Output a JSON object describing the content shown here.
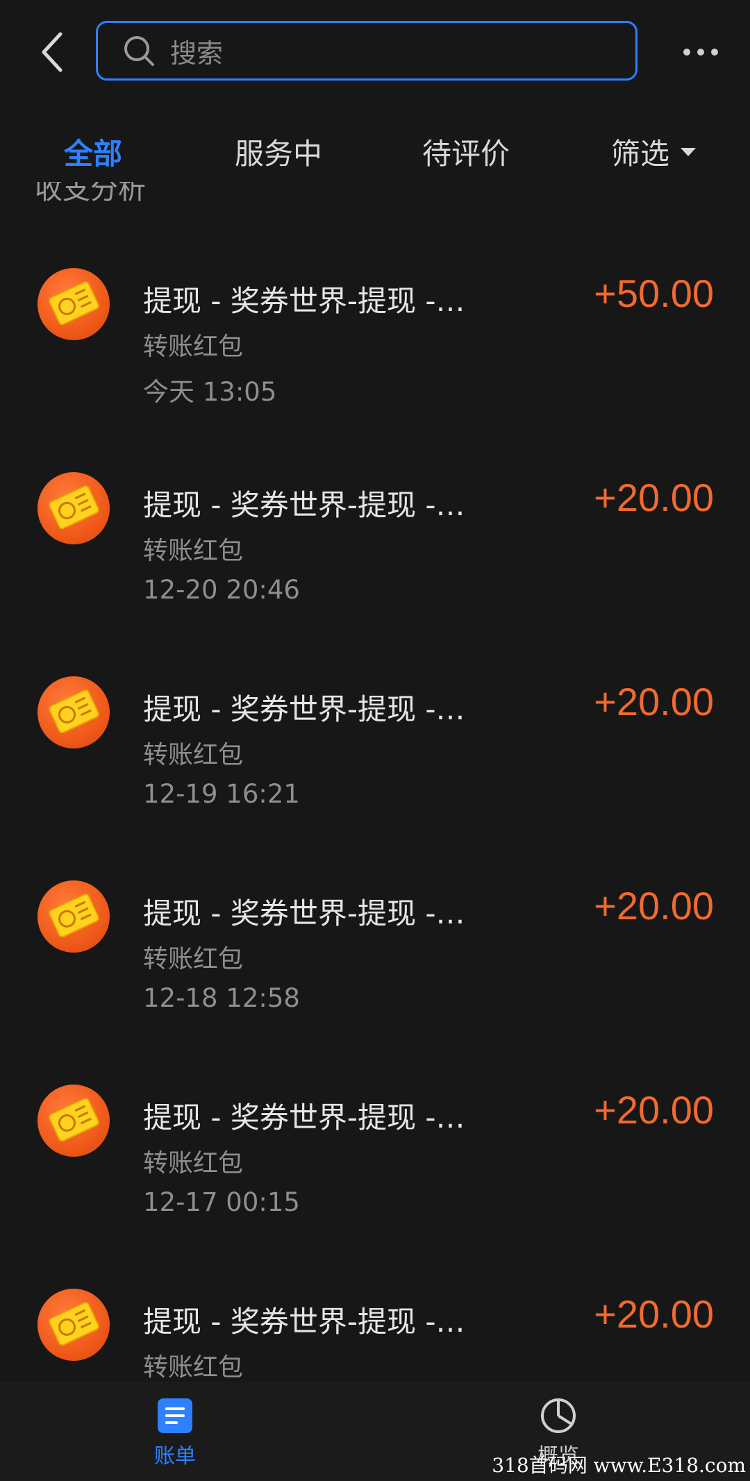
{
  "search": {
    "placeholder": "搜索"
  },
  "tabs": [
    {
      "label": "全部",
      "active": true
    },
    {
      "label": "服务中",
      "active": false
    },
    {
      "label": "待评价",
      "active": false
    },
    {
      "label": "筛选",
      "active": false
    }
  ],
  "partial_text": "收支分析",
  "transactions": [
    {
      "title": "提现 - 奖券世界-提现 -…",
      "subtitle": "转账红包",
      "time": "今天  13:05",
      "amount": "+50.00"
    },
    {
      "title": "提现 - 奖券世界-提现 -…",
      "subtitle": "转账红包",
      "time": "12-20  20:46",
      "amount": "+20.00"
    },
    {
      "title": "提现 - 奖券世界-提现 -…",
      "subtitle": "转账红包",
      "time": "12-19  16:21",
      "amount": "+20.00"
    },
    {
      "title": "提现 - 奖券世界-提现 -…",
      "subtitle": "转账红包",
      "time": "12-18  12:58",
      "amount": "+20.00"
    },
    {
      "title": "提现 - 奖券世界-提现 -…",
      "subtitle": "转账红包",
      "time": "12-17  00:15",
      "amount": "+20.00"
    },
    {
      "title": "提现 - 奖券世界-提现 -…",
      "subtitle": "转账红包",
      "time": "",
      "amount": "+20.00"
    }
  ],
  "bottom_nav": [
    {
      "label": "账单",
      "icon": "bill-icon",
      "active": true
    },
    {
      "label": "概览",
      "icon": "pie-chart-icon",
      "active": false
    }
  ],
  "watermark": "318首码网  www.E318.com",
  "colors": {
    "accent": "#2f80ff",
    "amount": "#f26a2e",
    "background": "#171717"
  }
}
